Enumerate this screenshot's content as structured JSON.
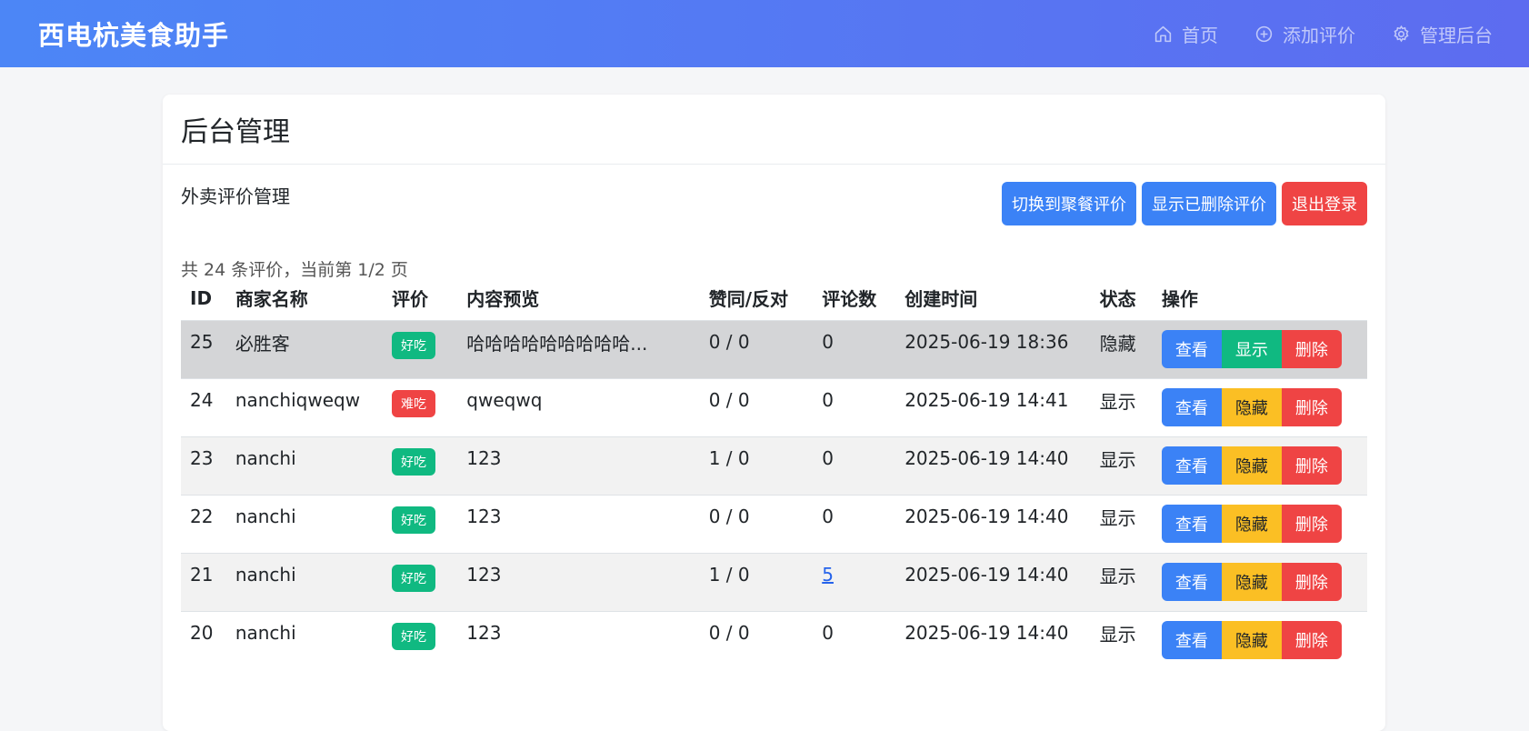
{
  "header": {
    "brand": "西电杭美食助手",
    "nav": [
      {
        "label": "首页",
        "icon": "home-icon"
      },
      {
        "label": "添加评价",
        "icon": "plus-circle-icon"
      },
      {
        "label": "管理后台",
        "icon": "gear-icon"
      }
    ]
  },
  "card": {
    "title": "后台管理",
    "section_label": "外卖评价管理",
    "buttons": {
      "switch": "切换到聚餐评价",
      "show_deleted": "显示已删除评价",
      "logout": "退出登录"
    },
    "summary": "共 24 条评价，当前第 1/2 页"
  },
  "table": {
    "headers": [
      "ID",
      "商家名称",
      "评价",
      "内容预览",
      "赞同/反对",
      "评论数",
      "创建时间",
      "状态",
      "操作"
    ],
    "op_labels": {
      "view": "查看",
      "show": "显示",
      "hide": "隐藏",
      "delete": "删除"
    },
    "rows": [
      {
        "id": "25",
        "merchant": "必胜客",
        "rating": "好吃",
        "preview": "哈哈哈哈哈哈哈哈哈...",
        "votes": "0 / 0",
        "comments": "0",
        "created": "2025-06-19 18:36",
        "status": "隐藏"
      },
      {
        "id": "24",
        "merchant": "nanchiqweqw",
        "rating": "难吃",
        "preview": "qweqwq",
        "votes": "0 / 0",
        "comments": "0",
        "created": "2025-06-19 14:41",
        "status": "显示"
      },
      {
        "id": "23",
        "merchant": "nanchi",
        "rating": "好吃",
        "preview": "123",
        "votes": "1 / 0",
        "comments": "0",
        "created": "2025-06-19 14:40",
        "status": "显示"
      },
      {
        "id": "22",
        "merchant": "nanchi",
        "rating": "好吃",
        "preview": "123",
        "votes": "0 / 0",
        "comments": "0",
        "created": "2025-06-19 14:40",
        "status": "显示"
      },
      {
        "id": "21",
        "merchant": "nanchi",
        "rating": "好吃",
        "preview": "123",
        "votes": "1 / 0",
        "comments": "5",
        "created": "2025-06-19 14:40",
        "status": "显示"
      },
      {
        "id": "20",
        "merchant": "nanchi",
        "rating": "好吃",
        "preview": "123",
        "votes": "0 / 0",
        "comments": "0",
        "created": "2025-06-19 14:40",
        "status": "显示"
      }
    ]
  }
}
